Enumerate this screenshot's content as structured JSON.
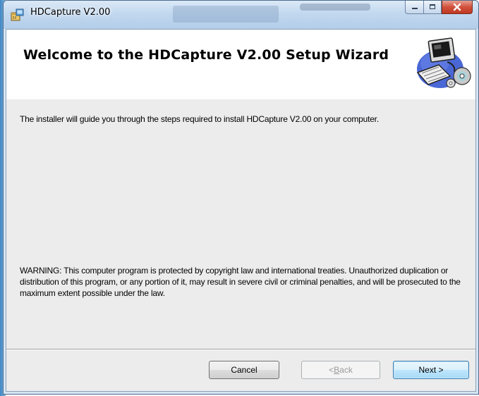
{
  "window": {
    "title": "HDCapture V2.00",
    "caption_buttons": [
      "minimize-icon",
      "maximize-icon",
      "close-icon"
    ]
  },
  "banner": {
    "title": "Welcome to the HDCapture V2.00 Setup Wizard",
    "icon": "computer-setup-icon"
  },
  "body": {
    "intro": "The installer will guide you through the steps required to install HDCapture V2.00 on your computer.",
    "warning": "WARNING: This computer program is protected by copyright law and international treaties. Unauthorized duplication or distribution of this program, or any portion of it, may result in severe civil or criminal penalties, and will be prosecuted to the maximum extent possible under the law."
  },
  "buttons": {
    "cancel": "Cancel",
    "back_prefix": "< ",
    "back_mnemonic": "B",
    "back_rest": "ack",
    "next": "Next >"
  },
  "colors": {
    "titlebar": "#c2d8ef",
    "close_button": "#d0513b",
    "client_background": "#ececec",
    "next_button_border": "#3c7fb1"
  }
}
